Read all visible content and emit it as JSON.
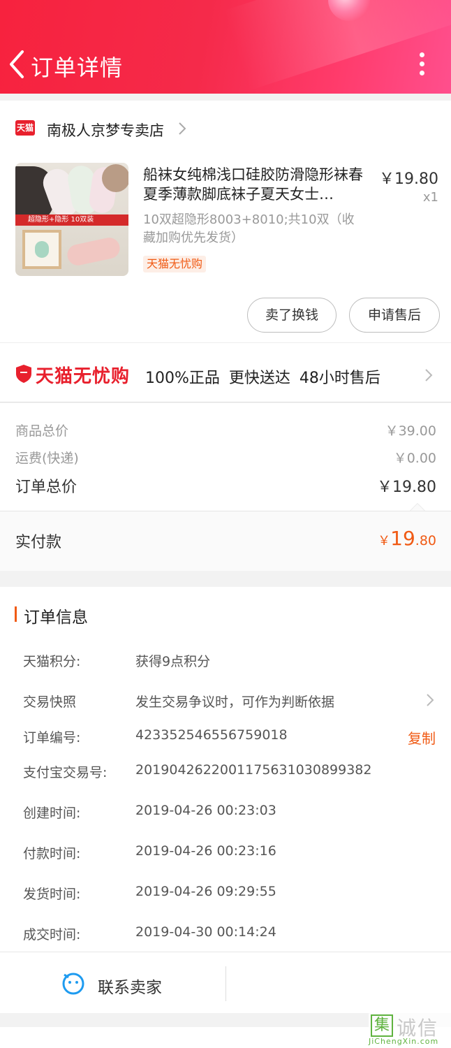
{
  "header": {
    "title": "订单详情"
  },
  "shop": {
    "badge": "天猫",
    "name": "南极人京梦专卖店"
  },
  "product": {
    "title": "船袜女纯棉浅口硅胶防滑隐形袜春夏季薄款脚底袜子夏天女士…",
    "price": "￥19.80",
    "quantity": "x1",
    "sku": "10双超隐形8003+8010;共10双（收藏加购优先发货）",
    "tag": "天猫无忧购",
    "image_text": "超隐形+隐形 10双装"
  },
  "actions": {
    "sell_label": "卖了换钱",
    "after_sale_label": "申请售后"
  },
  "promise": {
    "brand": "天猫无忧购",
    "text": "100%正品  更快送达  48小时售后"
  },
  "prices": {
    "goods_label": "商品总价",
    "goods_value": "￥39.00",
    "shipping_label": "运费(快递)",
    "shipping_value": "￥0.00",
    "total_label": "订单总价",
    "total_value": "￥19.80",
    "paid_label": "实付款",
    "paid_currency": "￥",
    "paid_int": "19",
    "paid_dec": ".80"
  },
  "order_info": {
    "title": "订单信息",
    "rows": [
      {
        "label": "天猫积分:",
        "value": "获得9点积分"
      },
      {
        "label": "交易快照",
        "value": "发生交易争议时，可作为判断依据"
      },
      {
        "label": "订单编号:",
        "value": "423352546556759018",
        "action": "复制"
      },
      {
        "label": "支付宝交易号:",
        "value": "2019042622001175631030899382"
      },
      {
        "label": "创建时间:",
        "value": "2019-04-26 00:23:03"
      },
      {
        "label": "付款时间:",
        "value": "2019-04-26 00:23:16"
      },
      {
        "label": "发货时间:",
        "value": "2019-04-26 09:29:55"
      },
      {
        "label": "成交时间:",
        "value": "2019-04-30 00:14:24"
      }
    ]
  },
  "contact": {
    "label": "联系卖家"
  },
  "watermark": {
    "logo": "集",
    "text": "诚信",
    "url": "JiChengXin.com"
  },
  "colors": {
    "header_red": "#f52a4a",
    "accent_orange": "#f05a14",
    "tmall_red": "#e8202d"
  }
}
